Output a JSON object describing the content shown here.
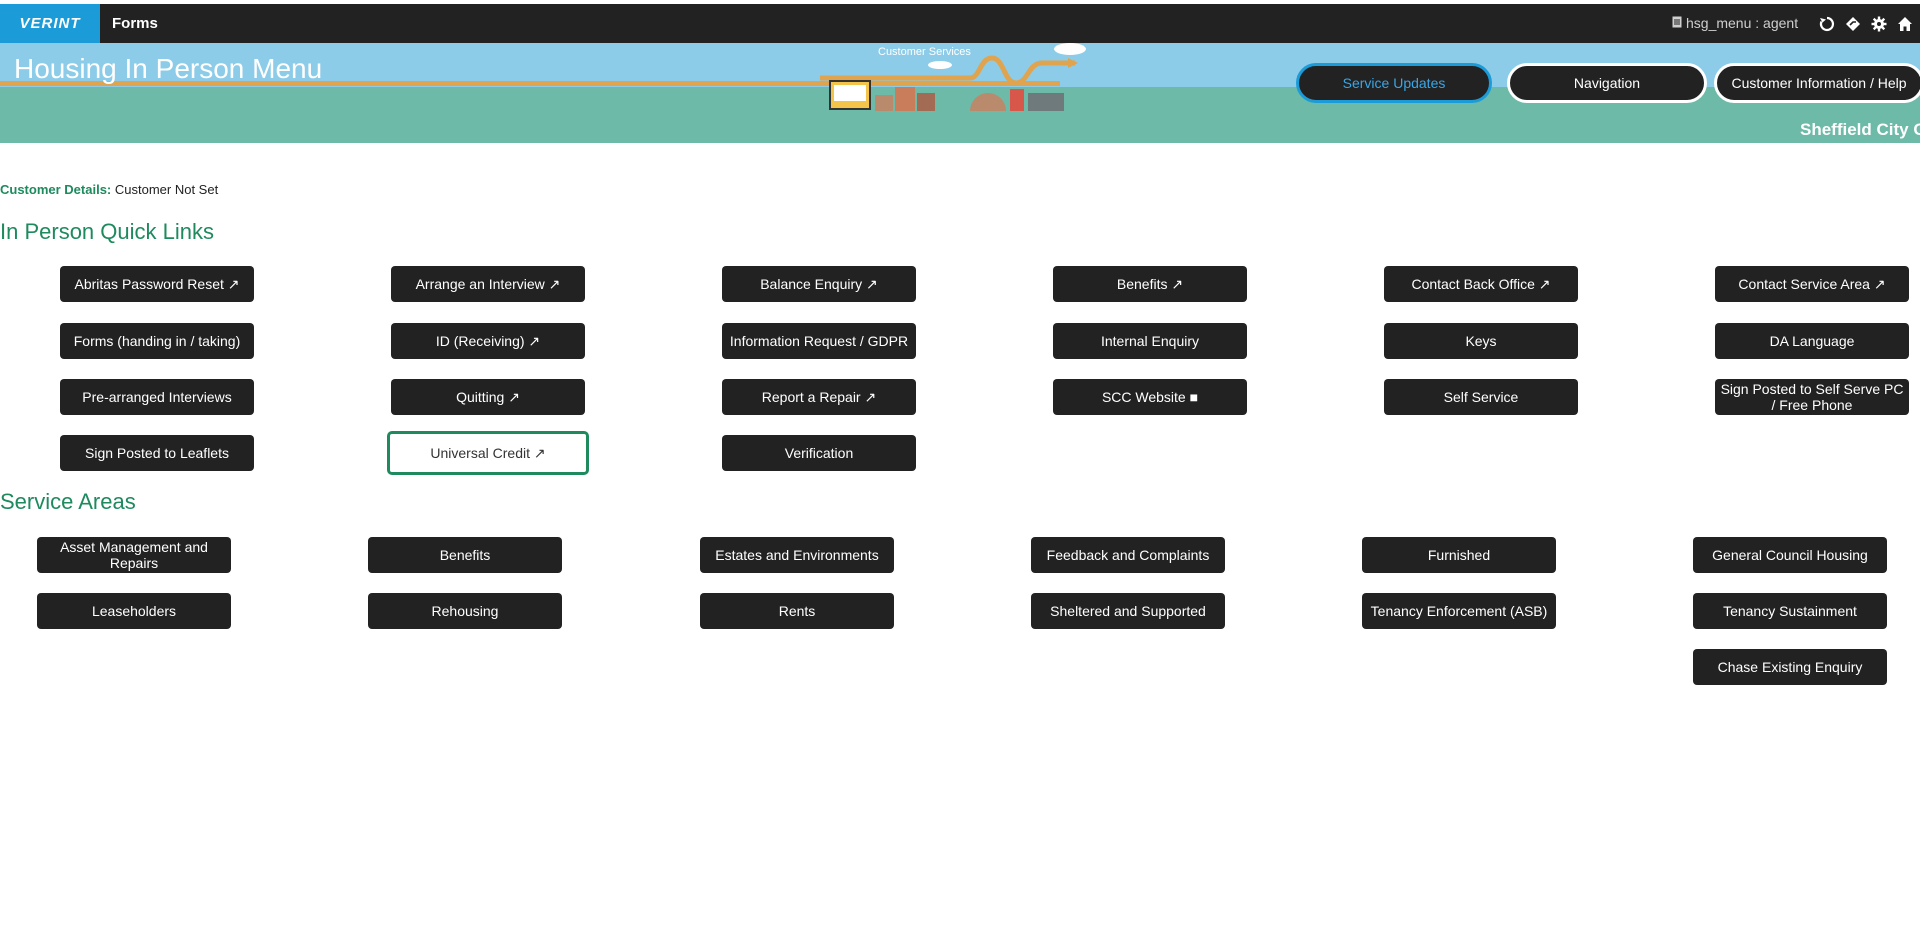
{
  "topbar": {
    "logo_text": "VERINT",
    "app_label": "Forms",
    "user_text": "hsg_menu : agent",
    "icons": [
      "refresh-icon",
      "navigate-icon",
      "settings-icon",
      "home-icon"
    ]
  },
  "banner": {
    "page_title": "Housing In Person Menu",
    "customer_services_label": "Customer Services",
    "council_text": "Sheffield City C",
    "buttons": {
      "service_updates": "Service Updates",
      "navigation": "Navigation",
      "customer_info": "Customer Information / Help"
    }
  },
  "customer": {
    "label": "Customer Details:",
    "value": "Customer Not Set"
  },
  "quick_links": {
    "title": "In Person Quick Links",
    "items": [
      "Abritas Password Reset ↗",
      "Arrange an Interview ↗",
      "Balance Enquiry ↗",
      "Benefits ↗",
      "Contact Back Office ↗",
      "Contact Service Area ↗",
      "Forms (handing in / taking)",
      "ID (Receiving) ↗",
      "Information Request / GDPR",
      "Internal Enquiry",
      "Keys",
      "DA Language",
      "Pre-arranged Interviews",
      "Quitting ↗",
      "Report a Repair ↗",
      "SCC Website ■",
      "Self Service",
      "Sign Posted to Self Serve PC / Free Phone",
      "Sign Posted to Leaflets",
      "Universal Credit ↗",
      "Verification"
    ]
  },
  "service_areas": {
    "title": "Service Areas",
    "items": [
      "Asset Management and Repairs",
      "Benefits",
      "Estates and Environments",
      "Feedback and Complaints",
      "Furnished",
      "General Council Housing",
      "Leaseholders",
      "Rehousing",
      "Rents",
      "Sheltered and Supported",
      "Tenancy Enforcement (ASB)",
      "Tenancy Sustainment",
      "Chase Existing Enquiry"
    ]
  },
  "colors": {
    "accent_green": "#1e8a5e",
    "button_dark": "#222222",
    "brand_blue": "#1b9bd8"
  }
}
